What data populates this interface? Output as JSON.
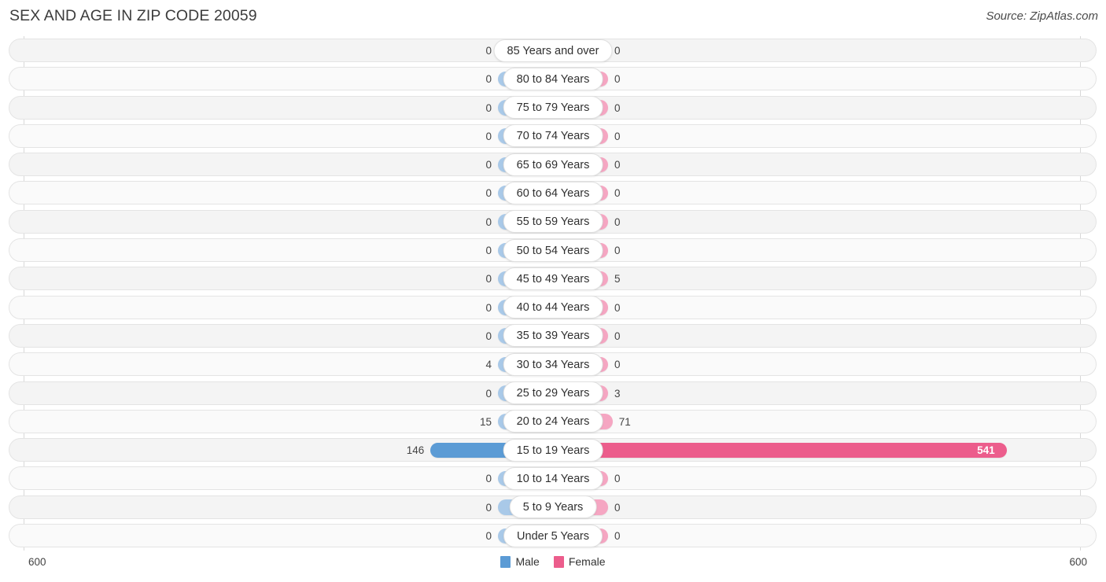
{
  "header": {
    "title": "SEX AND AGE IN ZIP CODE 20059",
    "source": "Source: ZipAtlas.com"
  },
  "axis": {
    "max_left": "600",
    "max_right": "600"
  },
  "legend": {
    "items": [
      {
        "label": "Male",
        "color": "#5b9bd5"
      },
      {
        "label": "Female",
        "color": "#ec5d8c"
      }
    ]
  },
  "colors": {
    "male": "#5b9bd5",
    "male_faded": "#a9c9e8",
    "female": "#ec5d8c",
    "female_faded": "#f5a6c2",
    "track": "#f4f4f4",
    "track_border": "#e4e4e4"
  },
  "chart_data": {
    "type": "bar",
    "title": "SEX AND AGE IN ZIP CODE 20059",
    "subtitle": "Source: ZipAtlas.com",
    "orientation": "horizontal-diverging",
    "xlabel": "",
    "ylabel": "",
    "xlim": [
      -600,
      600
    ],
    "axis_max": 600,
    "grid": false,
    "legend_position": "bottom-center",
    "categories": [
      "85 Years and over",
      "80 to 84 Years",
      "75 to 79 Years",
      "70 to 74 Years",
      "65 to 69 Years",
      "60 to 64 Years",
      "55 to 59 Years",
      "50 to 54 Years",
      "45 to 49 Years",
      "40 to 44 Years",
      "35 to 39 Years",
      "30 to 34 Years",
      "25 to 29 Years",
      "20 to 24 Years",
      "15 to 19 Years",
      "10 to 14 Years",
      "5 to 9 Years",
      "Under 5 Years"
    ],
    "series": [
      {
        "name": "Male",
        "values": [
          0,
          0,
          0,
          0,
          0,
          0,
          0,
          0,
          0,
          0,
          0,
          4,
          0,
          15,
          146,
          0,
          0,
          0
        ]
      },
      {
        "name": "Female",
        "values": [
          0,
          0,
          0,
          0,
          0,
          0,
          0,
          0,
          5,
          0,
          0,
          0,
          3,
          71,
          541,
          0,
          0,
          0
        ]
      }
    ],
    "highlighted_category": "15 to 19 Years"
  }
}
